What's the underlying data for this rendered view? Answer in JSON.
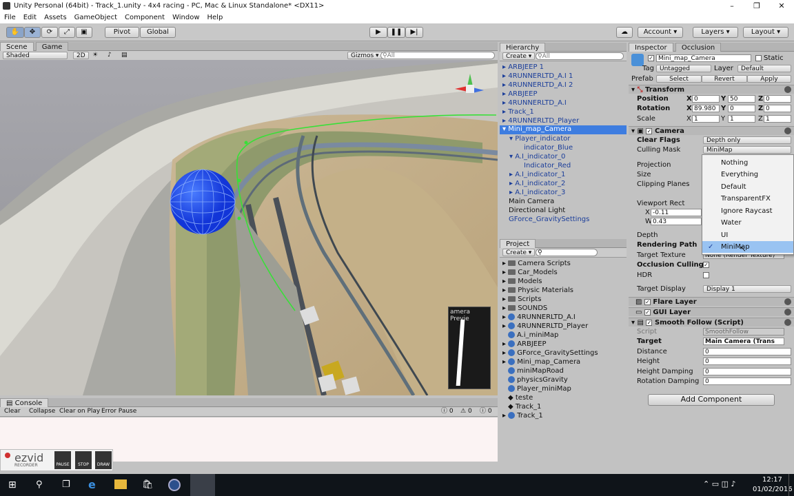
{
  "window": {
    "title": "Unity Personal (64bit) - Track_1.unity - 4x4 racing - PC, Mac & Linux Standalone* <DX11>",
    "min": "–",
    "max": "❐",
    "close": "✕"
  },
  "menu": [
    "File",
    "Edit",
    "Assets",
    "GameObject",
    "Component",
    "Window",
    "Help"
  ],
  "toolbar": {
    "pivot": "Pivot",
    "global": "Global",
    "account": "Account",
    "layers": "Layers",
    "layout": "Layout"
  },
  "scene": {
    "tab_scene": "Scene",
    "tab_game": "Game",
    "shading": "Shaded",
    "mode2d": "2D",
    "gizmos": "Gizmos",
    "search": "All",
    "cam_preview": "amera Previe"
  },
  "hierarchy": {
    "tab": "Hierarchy",
    "create": "Create",
    "search": "All",
    "items": [
      "ARBJEEP 1",
      "4RUNNERLTD_A.I 1",
      "4RUNNERLTD_A.I 2",
      "ARBJEEP",
      "4RUNNERLTD_A.I",
      "Track_1",
      "4RUNNERLTD_Player",
      "Mini_map_Camera",
      "Player_indicator",
      "indicator_Blue",
      "A.I_indicator_0",
      "Indicator_Red",
      "A.I_indicator_1",
      "A.I_indicator_2",
      "A.I_indicator_3",
      "Main Camera",
      "Directional Light",
      "GForce_GravitySettings"
    ]
  },
  "project": {
    "tab": "Project",
    "create": "Create",
    "items": [
      "Camera Scripts",
      "Car_Models",
      "Models",
      "Physic Materials",
      "Scripts",
      "SOUNDS",
      "4RUNNERLTD_A.I",
      "4RUNNERLTD_Player",
      "A.i_miniMap",
      "ARBJEEP",
      "GForce_GravitySettings",
      "Mini_map_Camera",
      "miniMapRoad",
      "physicsGravity",
      "Player_miniMap",
      "teste",
      "Track_1",
      "Track_1"
    ]
  },
  "inspector": {
    "tab": "Inspector",
    "tab2": "Occlusion",
    "name": "Mini_map_Camera",
    "static": "Static",
    "tag_label": "Tag",
    "tag": "Untagged",
    "layer_label": "Layer",
    "layer": "Default",
    "prefab": "Prefab",
    "select": "Select",
    "revert": "Revert",
    "apply": "Apply",
    "transform": "Transform",
    "position": "Position",
    "rotation": "Rotation",
    "scale": "Scale",
    "pos": [
      "0",
      "50",
      "0"
    ],
    "rot": [
      "89.980",
      "0",
      "0"
    ],
    "scl": [
      "1",
      "1",
      "1"
    ],
    "x": "X",
    "y": "Y",
    "z": "Z",
    "camera": "Camera",
    "clear_flags": "Clear Flags",
    "clear_flags_val": "Depth only",
    "culling_mask": "Culling Mask",
    "culling_val": "MiniMap",
    "projection": "Projection",
    "size": "Size",
    "clipping": "Clipping Planes",
    "viewport": "Viewport Rect",
    "vx": "-0.11",
    "vw": "0.43",
    "vxl": "X",
    "vwl": "W",
    "depth": "Depth",
    "rendering_path": "Rendering Path",
    "target_texture": "Target Texture",
    "target_tex_val": "None (Render Texture)",
    "occlusion": "Occlusion Culling",
    "hdr": "HDR",
    "target_display": "Target Display",
    "target_display_val": "Display 1",
    "flare": "Flare Layer",
    "gui": "GUI Layer",
    "smooth": "Smooth Follow (Script)",
    "script": "Script",
    "script_val": "SmoothFollow",
    "target": "Target",
    "target_val": "Main Camera (Trans",
    "distance": "Distance",
    "height": "Height",
    "height_damp": "Height Damping",
    "rot_damp": "Rotation Damping",
    "zero": "0",
    "add_component": "Add Component"
  },
  "dropdown": [
    "Nothing",
    "Everything",
    "Default",
    "TransparentFX",
    "Ignore Raycast",
    "Water",
    "UI",
    "MiniMap"
  ],
  "console": {
    "tab": "Console",
    "clear": "Clear",
    "collapse": "Collapse",
    "clear_on_play": "Clear on Play",
    "error_pause": "Error Pause",
    "c1": "0",
    "c2": "0",
    "c3": "0"
  },
  "ezvid": {
    "logo": "ezvid",
    "sub": "RECORDER",
    "pause": "PAUSE",
    "stop": "STOP",
    "draw": "DRAW"
  },
  "taskbar": {
    "time": "12:17",
    "date": "01/02/2016"
  }
}
